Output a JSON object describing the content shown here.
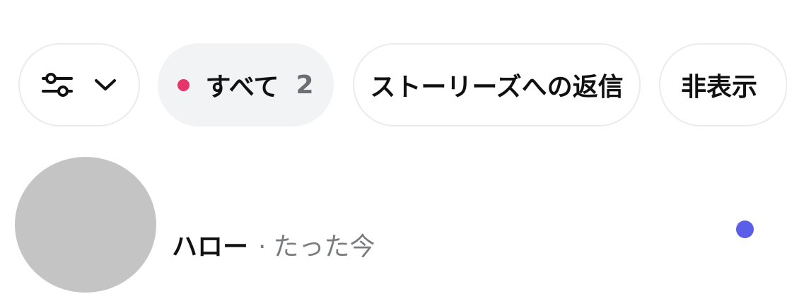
{
  "filters": {
    "all_label": "すべて",
    "all_count": "2",
    "story_replies_label": "ストーリーズへの返信",
    "hidden_label": "非表示",
    "filter_icon": "sliders-icon",
    "dropdown_icon": "chevron-down-icon"
  },
  "message": {
    "name": "ハロー",
    "separator": "·",
    "time": "たった今"
  },
  "colors": {
    "active_dot": "#e6356a",
    "unread_dot": "#5b5ee8",
    "selected_chip_bg": "#f1f3f4"
  }
}
